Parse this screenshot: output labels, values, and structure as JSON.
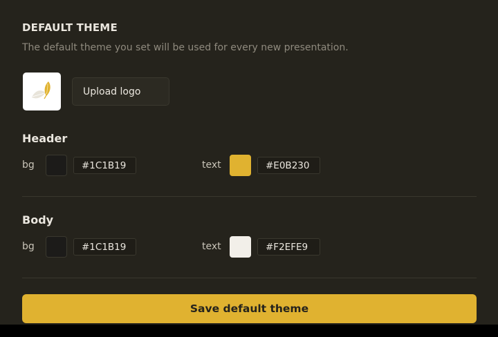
{
  "theme": {
    "title": "DEFAULT THEME",
    "subtitle": "The default theme you set will be used for every new presentation.",
    "upload_logo_label": "Upload logo",
    "logo_icon": "leaf-logo-icon"
  },
  "header": {
    "label": "Header",
    "bg_label": "bg",
    "bg_value": "#1C1B19",
    "text_label": "text",
    "text_value": "#E0B230"
  },
  "body": {
    "label": "Body",
    "bg_label": "bg",
    "bg_value": "#1C1B19",
    "text_label": "text",
    "text_value": "#F2EFE9"
  },
  "colors": {
    "panel_bg": "#25231c",
    "accent": "#e0b230"
  },
  "save_label": "Save default theme"
}
